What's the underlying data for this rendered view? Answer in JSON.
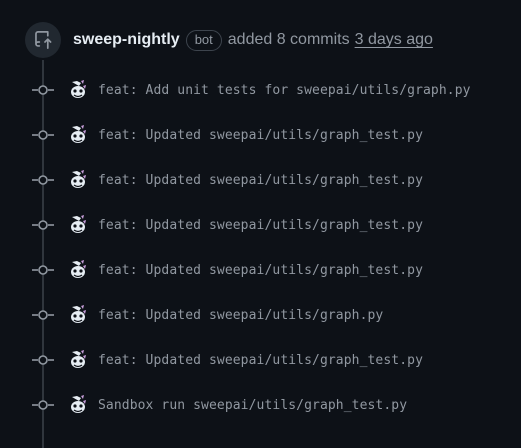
{
  "event": {
    "actor": "sweep-nightly",
    "actor_badge": "bot",
    "action": "added 8 commits",
    "time": "3 days ago",
    "icon": "repo-push-icon"
  },
  "commits": [
    {
      "message": "feat: Add unit tests for sweepai/utils/graph.py",
      "avatar_icon": "sweep-bot-avatar"
    },
    {
      "message": "feat: Updated sweepai/utils/graph_test.py",
      "avatar_icon": "sweep-bot-avatar"
    },
    {
      "message": "feat: Updated sweepai/utils/graph_test.py",
      "avatar_icon": "sweep-bot-avatar"
    },
    {
      "message": "feat: Updated sweepai/utils/graph_test.py",
      "avatar_icon": "sweep-bot-avatar"
    },
    {
      "message": "feat: Updated sweepai/utils/graph_test.py",
      "avatar_icon": "sweep-bot-avatar"
    },
    {
      "message": "feat: Updated sweepai/utils/graph.py",
      "avatar_icon": "sweep-bot-avatar"
    },
    {
      "message": "feat: Updated sweepai/utils/graph_test.py",
      "avatar_icon": "sweep-bot-avatar"
    },
    {
      "message": "Sandbox run sweepai/utils/graph_test.py",
      "avatar_icon": "sweep-bot-avatar"
    }
  ],
  "colors": {
    "background": "#0d1117",
    "muted_text": "#9198a1",
    "primary_text": "#e6edf3",
    "timeline": "#30363d"
  }
}
